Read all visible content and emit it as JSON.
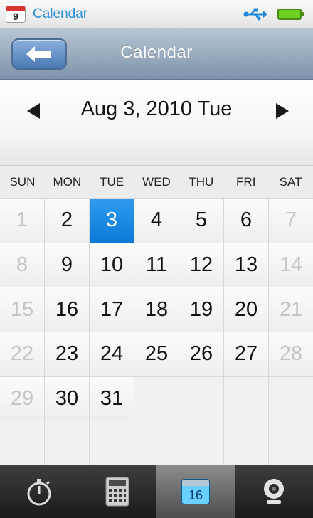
{
  "status_bar": {
    "app_icon_number": "9",
    "title": "Calendar",
    "colors": {
      "title": "#2b8fd6",
      "battery": "#6fcf22"
    }
  },
  "nav_bar": {
    "title": "Calendar"
  },
  "date_header": {
    "date_text": "Aug 3, 2010 Tue"
  },
  "weekdays": [
    "SUN",
    "MON",
    "TUE",
    "WED",
    "THU",
    "FRI",
    "SAT"
  ],
  "calendar": {
    "selected_day": "3",
    "cells": [
      {
        "day": "1",
        "state": "muted"
      },
      {
        "day": "2",
        "state": "normal"
      },
      {
        "day": "3",
        "state": "selected"
      },
      {
        "day": "4",
        "state": "normal"
      },
      {
        "day": "5",
        "state": "normal"
      },
      {
        "day": "6",
        "state": "normal"
      },
      {
        "day": "7",
        "state": "muted"
      },
      {
        "day": "8",
        "state": "muted"
      },
      {
        "day": "9",
        "state": "normal"
      },
      {
        "day": "10",
        "state": "normal"
      },
      {
        "day": "11",
        "state": "normal"
      },
      {
        "day": "12",
        "state": "normal"
      },
      {
        "day": "13",
        "state": "normal"
      },
      {
        "day": "14",
        "state": "muted"
      },
      {
        "day": "15",
        "state": "muted"
      },
      {
        "day": "16",
        "state": "normal"
      },
      {
        "day": "17",
        "state": "normal"
      },
      {
        "day": "18",
        "state": "normal"
      },
      {
        "day": "19",
        "state": "normal"
      },
      {
        "day": "20",
        "state": "normal"
      },
      {
        "day": "21",
        "state": "muted"
      },
      {
        "day": "22",
        "state": "muted"
      },
      {
        "day": "23",
        "state": "normal"
      },
      {
        "day": "24",
        "state": "normal"
      },
      {
        "day": "25",
        "state": "normal"
      },
      {
        "day": "26",
        "state": "normal"
      },
      {
        "day": "27",
        "state": "normal"
      },
      {
        "day": "28",
        "state": "muted"
      },
      {
        "day": "29",
        "state": "muted"
      },
      {
        "day": "30",
        "state": "normal"
      },
      {
        "day": "31",
        "state": "normal"
      },
      {
        "day": "",
        "state": "empty"
      },
      {
        "day": "",
        "state": "empty"
      },
      {
        "day": "",
        "state": "empty"
      },
      {
        "day": "",
        "state": "empty"
      },
      {
        "day": "",
        "state": "empty"
      },
      {
        "day": "",
        "state": "empty"
      },
      {
        "day": "",
        "state": "empty"
      },
      {
        "day": "",
        "state": "empty"
      },
      {
        "day": "",
        "state": "empty"
      },
      {
        "day": "",
        "state": "empty"
      },
      {
        "day": "",
        "state": "empty"
      }
    ],
    "colors": {
      "selected": "#1a8ae6",
      "muted_text": "#c4c4c4"
    }
  },
  "tab_bar": {
    "tabs": [
      {
        "icon": "stopwatch-icon",
        "active": false
      },
      {
        "icon": "calculator-icon",
        "active": false
      },
      {
        "icon": "calendar-icon",
        "active": true,
        "number": "16"
      },
      {
        "icon": "webcam-icon",
        "active": false
      }
    ]
  }
}
